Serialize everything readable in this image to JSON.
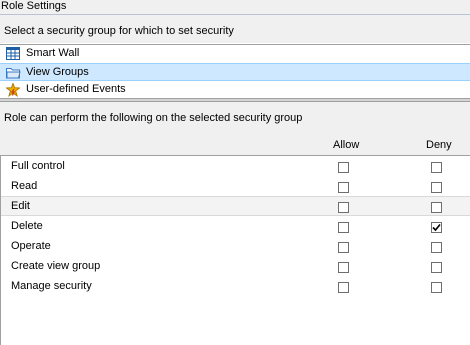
{
  "window": {
    "title": "Role Settings"
  },
  "security_groups": {
    "caption": "Select a security group for which to set security",
    "items": [
      {
        "label": "Smart Wall",
        "icon": "grid-icon",
        "selected": false
      },
      {
        "label": "View Groups",
        "icon": "folder-icon",
        "selected": true
      },
      {
        "label": "User-defined Events",
        "icon": "event-icon",
        "selected": false
      }
    ]
  },
  "permissions": {
    "caption": "Role can perform the following on the selected security group",
    "columns": {
      "allow": "Allow",
      "deny": "Deny"
    },
    "rows": [
      {
        "name": "Full control",
        "allow": false,
        "deny": false
      },
      {
        "name": "Read",
        "allow": false,
        "deny": false
      },
      {
        "name": "Edit",
        "allow": false,
        "deny": false
      },
      {
        "name": "Delete",
        "allow": false,
        "deny": true
      },
      {
        "name": "Operate",
        "allow": false,
        "deny": false
      },
      {
        "name": "Create view group",
        "allow": false,
        "deny": false
      },
      {
        "name": "Manage security",
        "allow": false,
        "deny": false
      }
    ]
  },
  "colors": {
    "selection_bg": "#cde8ff",
    "panel_bg": "#f0f0f0"
  }
}
